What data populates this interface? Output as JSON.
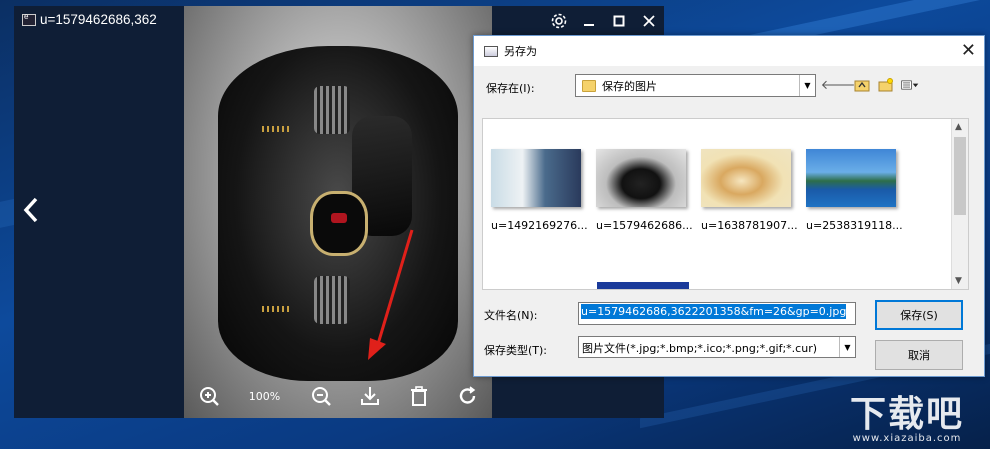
{
  "viewer": {
    "title": "u=1579462686,362",
    "zoom": "100%",
    "controls": [
      "settings-icon",
      "minimize-icon",
      "maximize-icon",
      "close-icon"
    ],
    "toolbar_icons": [
      "zoom-in-icon",
      "zoom-out-icon",
      "download-icon",
      "delete-icon",
      "rotate-icon"
    ]
  },
  "dialog": {
    "title": "另存为",
    "save_in_label": "保存在(I):",
    "save_in_value": "保存的图片",
    "files": [
      {
        "name": "u=1492169276...",
        "icon": "anime-thumbnail"
      },
      {
        "name": "u=1579462686...",
        "icon": "car-thumbnail"
      },
      {
        "name": "u=1638781907...",
        "icon": "dog-thumbnail"
      },
      {
        "name": "u=2538319118...",
        "icon": "island-thumbnail"
      }
    ],
    "filename_label": "文件名(N):",
    "filename_value": "u=1579462686,3622201358&fm=26&gp=0.jpg",
    "filetype_label": "保存类型(T):",
    "filetype_value": "图片文件(*.jpg;*.bmp;*.ico;*.png;*.gif;*.cur)",
    "save_button": "保存(S)",
    "cancel_button": "取消"
  },
  "watermark": {
    "main": "下载吧",
    "url": "www.xiazaiba.com"
  },
  "colors": {
    "selection": "#0078d7",
    "annotation_arrow": "#e0201a",
    "desktop": "#0d4a9c"
  }
}
